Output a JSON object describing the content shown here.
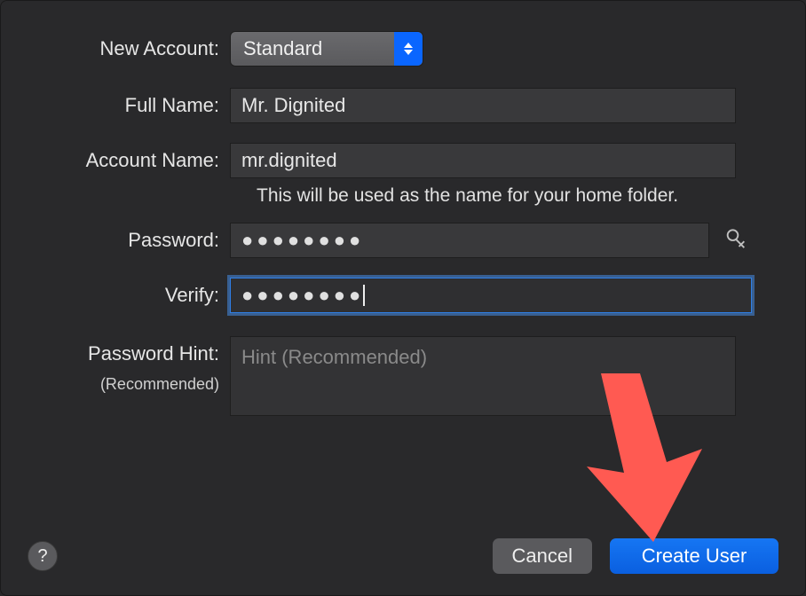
{
  "labels": {
    "new_account": "New Account:",
    "full_name": "Full Name:",
    "account_name": "Account Name:",
    "password": "Password:",
    "verify": "Verify:",
    "password_hint": "Password Hint:",
    "recommended": "(Recommended)"
  },
  "fields": {
    "new_account_value": "Standard",
    "full_name_value": "Mr. Dignited",
    "account_name_value": "mr.dignited",
    "account_name_helper": "This will be used as the name for your home folder.",
    "password_mask": "●●●●●●●●",
    "verify_mask": "●●●●●●●●",
    "password_hint_placeholder": "Hint (Recommended)"
  },
  "buttons": {
    "cancel": "Cancel",
    "create_user": "Create User",
    "help": "?"
  }
}
